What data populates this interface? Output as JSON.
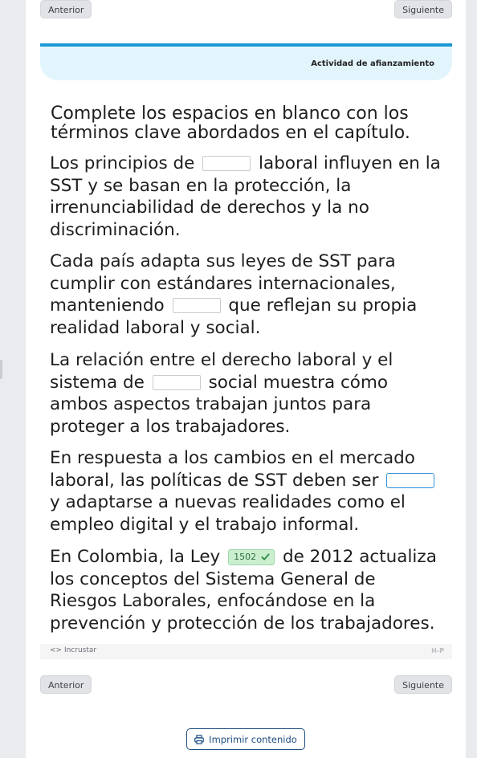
{
  "nav": {
    "prev_label": "Anterior",
    "next_label": "Siguiente"
  },
  "banner": {
    "title": "Actividad de afianzamiento"
  },
  "instructions": "Complete los espacios en blanco con los términos clave abordados en el capítulo.",
  "sentences": [
    {
      "before": "Los principios de",
      "after": "laboral influyen en la SST y se basan en la protección, la irrenunciabilidad de derechos y la no discriminación.",
      "blank": ""
    },
    {
      "before": "Cada país adapta sus leyes de SST para cumplir con estándares internacionales, manteniendo",
      "after": "que reflejan su propia realidad laboral y social.",
      "blank": ""
    },
    {
      "before": "La relación entre el derecho laboral y el sistema de",
      "after": "social muestra cómo ambos aspectos trabajan juntos para proteger a los trabajadores.",
      "blank": ""
    },
    {
      "before": "En respuesta a los cambios en el mercado laboral, las políticas de SST deben ser",
      "after": "y adaptarse a nuevas realidades como el empleo digital y el trabajo informal.",
      "blank": ""
    },
    {
      "before": "En Colombia, la Ley",
      "after": "de 2012 actualiza los conceptos del Sistema General de Riesgos Laborales, enfocándose en la prevención y protección de los trabajadores.",
      "blank": "1502"
    }
  ],
  "footer": {
    "embed_label": "<> Incrustar",
    "logo_text": "H-P"
  },
  "print_label": "Imprimir contenido",
  "colors": {
    "accent_blue": "#1a9ad6",
    "banner_bg": "#e3f5fc",
    "correct_green": "#c9efcf",
    "print_border": "#1d4e80"
  },
  "icons": {
    "correct": "check-icon",
    "print": "print-icon"
  }
}
